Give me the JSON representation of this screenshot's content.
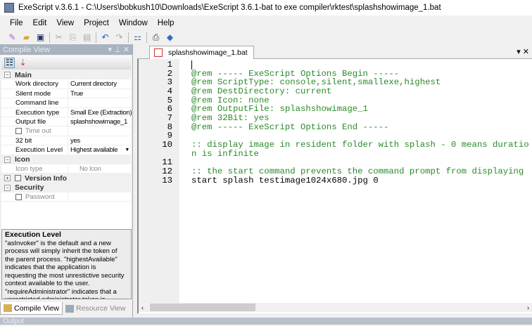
{
  "window": {
    "title": "ExeScript v.3.6.1 - C:\\Users\\bobkush10\\Downloads\\ExeScript 3.6.1-bat to exe compiler\\rktest\\splashshowimage_1.bat"
  },
  "menu": [
    "File",
    "Edit",
    "View",
    "Project",
    "Window",
    "Help"
  ],
  "compile_view": {
    "title": "Compile View",
    "categories": {
      "main": "Main",
      "icon": "Icon",
      "version": "Version Info",
      "security": "Security"
    },
    "main_rows": [
      {
        "key": "Work directory",
        "value": "Current directory"
      },
      {
        "key": "Silent mode",
        "value": "True"
      },
      {
        "key": "Command line",
        "value": ""
      },
      {
        "key": "Execution type",
        "value": "Small Exe (Extraction)"
      },
      {
        "key": "Output file",
        "value": "splashshowimage_1"
      },
      {
        "key": "Time out",
        "value": ""
      },
      {
        "key": "32 bit",
        "value": "yes"
      },
      {
        "key": "Execution Level",
        "value": "Highest available"
      }
    ],
    "icon_row": {
      "key": "Icon type",
      "value": "No Icon"
    },
    "password_label": "Password",
    "description": {
      "title": "Execution Level",
      "text": "\"asInvoker\" is the default and a new process will simply inherit the token of the parent process. \"highestAvailable\" indicates that the application is requesting the most unrestictive security context available to the user. \"requireAdministrator\" indicates that a unrestricted administrator token is needed. Standard users will be prompted for administrator"
    }
  },
  "bottom_tabs": [
    "Compile View",
    "Resource View"
  ],
  "editor": {
    "tab": "splashshowimage_1.bat",
    "lines": [
      {
        "n": "1",
        "text": "",
        "comment": false
      },
      {
        "n": "2",
        "text": "@rem ----- ExeScript Options Begin -----",
        "comment": true
      },
      {
        "n": "3",
        "text": "@rem ScriptType: console,silent,smallexe,highest",
        "comment": true
      },
      {
        "n": "4",
        "text": "@rem DestDirectory: current",
        "comment": true
      },
      {
        "n": "5",
        "text": "@rem Icon: none",
        "comment": true
      },
      {
        "n": "6",
        "text": "@rem OutputFile: splashshowimage_1",
        "comment": true
      },
      {
        "n": "7",
        "text": "@rem 32Bit: yes",
        "comment": true
      },
      {
        "n": "8",
        "text": "@rem ----- ExeScript Options End -----",
        "comment": true
      },
      {
        "n": "9",
        "text": "",
        "comment": false
      },
      {
        "n": "10",
        "text": ":: display image in resident folder with splash - 0 means duration is infinite",
        "comment": true
      },
      {
        "n": "11",
        "text": "",
        "comment": false
      },
      {
        "n": "12",
        "text": ":: the start command prevents the command prompt from displaying",
        "comment": true
      },
      {
        "n": "13",
        "text": "start splash testimage1024x680.jpg 0",
        "comment": false
      }
    ]
  },
  "output": {
    "title": "Output"
  }
}
